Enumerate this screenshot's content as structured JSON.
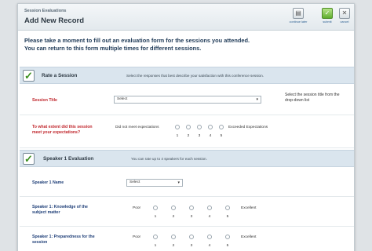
{
  "window": {
    "subtitle": "Session Evaluations",
    "title": "Add New Record"
  },
  "toolbar": {
    "continue_later": "continue later",
    "submit": "submit",
    "cancel": "cancel"
  },
  "intro": {
    "line1": "Please take a moment to fill out an evaluation form for the sessions you attended.",
    "line2": "You can return to this form multiple times for different sessions."
  },
  "section1": {
    "title": "Rate a Session",
    "desc": "Select the responses that best describe your satisfaction with this conference session."
  },
  "session_title": {
    "label": "Session Title",
    "select_value": "Select",
    "hint_line1": "Select the session title from the",
    "hint_line2": "drop-down list"
  },
  "expectations": {
    "label_line1": "To what extent did this session",
    "label_line2": "meet your expectations?",
    "low": "Did not meet expectations",
    "high": "Exceeded Expectations",
    "scale": [
      "1",
      "2",
      "3",
      "4",
      "5"
    ]
  },
  "section2": {
    "title": "Speaker 1 Evaluation",
    "desc": "You can rate up to 4 speakers for each session."
  },
  "speaker_name": {
    "label": "Speaker 1 Name",
    "select_value": "Select"
  },
  "knowledge": {
    "label_line1": "Speaker 1: Knowledge of the",
    "label_line2": "subject matter",
    "low": "Poor",
    "high": "Excellent",
    "scale": [
      "1",
      "2",
      "3",
      "4",
      "5"
    ]
  },
  "preparedness": {
    "label_line1": "Speaker 1: Preparedness for the",
    "label_line2": "session",
    "low": "Poor",
    "high": "Excellent",
    "scale": [
      "1",
      "2",
      "3",
      "4",
      "5"
    ]
  },
  "icons": {
    "continue_later": "document-icon",
    "submit": "checkmark-icon",
    "cancel": "close-icon",
    "section_check": "checkbox-checked-icon"
  }
}
